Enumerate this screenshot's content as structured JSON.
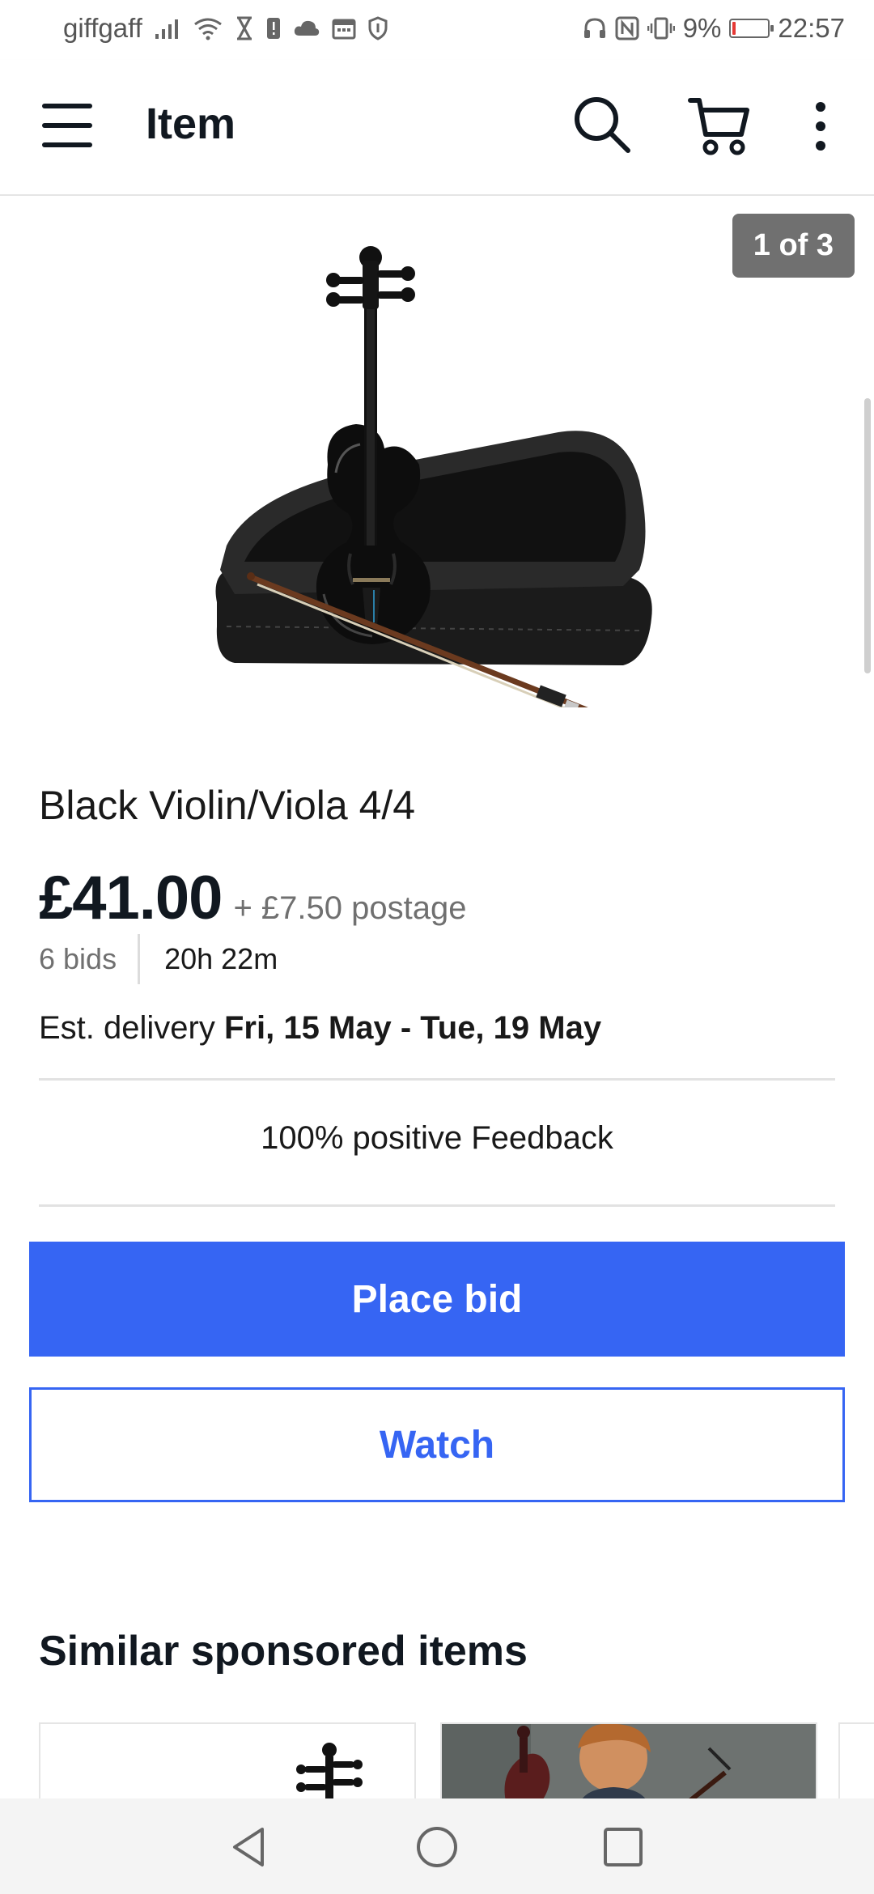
{
  "status_bar": {
    "carrier": "giffgaff",
    "battery_percent": "9%",
    "battery_level": 0.09,
    "time": "22:57",
    "icons_left": [
      "signal-icon",
      "wifi-icon",
      "hourglass-icon",
      "alert-icon",
      "cloud-icon",
      "calendar-icon",
      "shield-icon"
    ],
    "icons_right": [
      "headphones-icon",
      "nfc-icon",
      "vibrate-icon",
      "battery-icon"
    ]
  },
  "app_bar": {
    "title": "Item"
  },
  "gallery": {
    "counter": "1 of 3"
  },
  "item": {
    "title": "Black Violin/Viola 4/4",
    "price": "£41.00",
    "postage": "+ £7.50 postage",
    "bids": "6 bids",
    "time_left": "20h 22m",
    "delivery_label": "Est. delivery",
    "delivery_dates": "Fri, 15 May - Tue, 19 May",
    "feedback": "100% positive Feedback"
  },
  "actions": {
    "place_bid": "Place bid",
    "watch": "Watch"
  },
  "similar": {
    "title": "Similar sponsored items"
  },
  "colors": {
    "accent": "#3665f3",
    "text": "#111820",
    "muted": "#707070",
    "counter_bg": "#707070",
    "battery_low": "#e53935"
  }
}
